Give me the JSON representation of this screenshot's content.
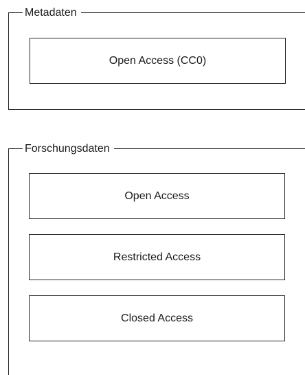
{
  "groups": {
    "metadata": {
      "title": "Metadaten",
      "boxes": [
        {
          "label": "Open Access (CC0)"
        }
      ]
    },
    "research_data": {
      "title": "Forschungsdaten",
      "boxes": [
        {
          "label": "Open Access"
        },
        {
          "label": "Restricted Access"
        },
        {
          "label": "Closed Access"
        }
      ]
    }
  }
}
